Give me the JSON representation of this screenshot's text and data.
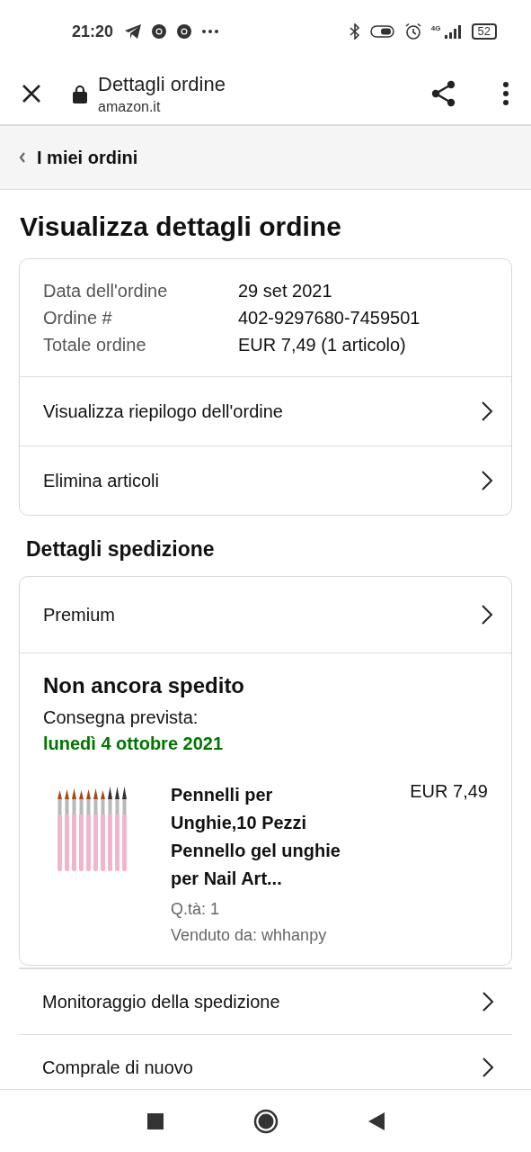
{
  "status_bar": {
    "time": "21:20",
    "network": "4G",
    "battery": "52"
  },
  "toolbar": {
    "title": "Dettagli ordine",
    "url": "amazon.it"
  },
  "breadcrumb": "I miei ordini",
  "page_title": "Visualizza dettagli ordine",
  "order_info": [
    {
      "label": "Data dell'ordine",
      "value": "29 set 2021"
    },
    {
      "label": "Ordine #",
      "value": "402-9297680-7459501"
    },
    {
      "label": "Totale ordine",
      "value": "EUR 7,49 (1 articolo)"
    }
  ],
  "order_links": [
    "Visualizza riepilogo dell'ordine",
    "Elimina articoli"
  ],
  "shipping": {
    "heading": "Dettagli spedizione",
    "service": "Premium",
    "status": "Non ancora spedito",
    "delivery_label": "Consegna prevista:",
    "delivery_date": "lunedì 4 ottobre 2021",
    "item": {
      "kind": "picture",
      "title": "Pennelli per Unghie,10 Pezzi Pennello gel unghie per Nail Art...",
      "price": "EUR 7,49",
      "quantity": "Q.tà: 1",
      "seller": "Venduto da: whhanpy"
    }
  },
  "actions": [
    "Monitoraggio della spedizione",
    "Comprale di nuovo"
  ]
}
